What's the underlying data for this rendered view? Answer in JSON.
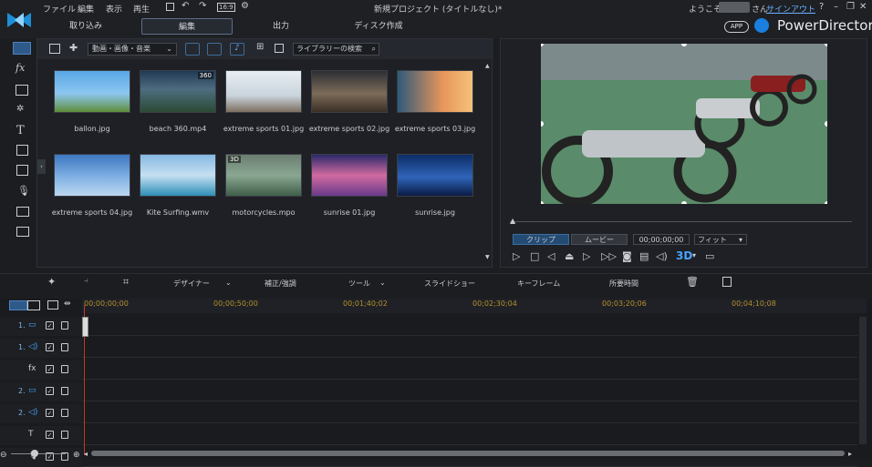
{
  "menu": {
    "file": "ファイル",
    "edit": "編集",
    "view": "表示",
    "play": "再生",
    "format": "16:9"
  },
  "window_title": "新規プロジェクト (タイトルなし)*",
  "account": {
    "welcome": "ようこそ",
    "suffix": "さん",
    "signout": "サインアウト"
  },
  "tabs": {
    "capture": "取り込み",
    "edit": "編集",
    "output": "出力",
    "disc": "ディスク作成"
  },
  "brand": {
    "app_badge": "APP",
    "name": "PowerDirector"
  },
  "window_controls": {
    "help": "?",
    "minimize": "–",
    "restore": "❐",
    "close": "✕"
  },
  "library": {
    "filter": "動画・画像・音楽",
    "search_placeholder": "ライブラリーの検索",
    "items": [
      {
        "name": "ballon.jpg",
        "bg": "linear-gradient(180deg,#59a7e6 0%,#8dc6f0 55%,#5f8e3a 100%)"
      },
      {
        "name": "beach 360.mp4",
        "bg": "linear-gradient(180deg,#223a55 0%,#4d6d80 45%,#2b4a34 100%)",
        "badge": "360"
      },
      {
        "name": "extreme sports 01.jpg",
        "bg": "linear-gradient(180deg,#e8eef3 0%,#c9d4dc 60%,#7d6f60 100%)"
      },
      {
        "name": "extreme sports 02.jpg",
        "bg": "linear-gradient(180deg,#2c2f34 0%,#7c6b58 55%,#3a2f25 100%)"
      },
      {
        "name": "extreme sports 03.jpg",
        "bg": "linear-gradient(90deg,#2e5a7a 0%,#e8955a 60%,#f4c27a 100%)"
      },
      {
        "name": "extreme sports 04.jpg",
        "bg": "linear-gradient(180deg,#3d78c2 0%,#88b6e6 60%,#bcd7f0 100%)"
      },
      {
        "name": "Kite Surfing.wmv",
        "bg": "linear-gradient(180deg,#86b8e2 0%,#c5e0f2 50%,#2f8fb6 100%)"
      },
      {
        "name": "motorcycles.mpo",
        "bg": "linear-gradient(180deg,#6b7d70 0%,#8aa792 50%,#3f5e48 100%)",
        "badge": "3D"
      },
      {
        "name": "sunrise 01.jpg",
        "bg": "linear-gradient(180deg,#2b2a6a 0%,#d06aa0 50%,#6a3a8a 100%)"
      },
      {
        "name": "sunrise.jpg",
        "bg": "linear-gradient(180deg,#0c2d66 0%,#2f64b8 55%,#0a1b44 100%)"
      }
    ]
  },
  "preview": {
    "tab_clip": "クリップ",
    "tab_movie": "ムービー",
    "timecode": "00;00;00;00",
    "fit": "フィット",
    "mode_3d": "3D"
  },
  "edit_toolbar": {
    "designer": "デザイナー",
    "correct": "補正/強調",
    "tools": "ツール",
    "slideshow": "スライドショー",
    "keyframe": "キーフレーム",
    "duration": "所要時間"
  },
  "timeline": {
    "ticks": [
      "00;00;00;00",
      "00;00;50;00",
      "00;01;40;02",
      "00;02;30;04",
      "00;03;20;06",
      "00;04;10;08"
    ],
    "tracks": [
      {
        "label": "1.",
        "type": "video"
      },
      {
        "label": "1.",
        "type": "audio"
      },
      {
        "label": "",
        "type": "fx"
      },
      {
        "label": "2.",
        "type": "video"
      },
      {
        "label": "2.",
        "type": "audio"
      },
      {
        "label": "",
        "type": "title"
      },
      {
        "label": "",
        "type": "voice"
      }
    ]
  }
}
